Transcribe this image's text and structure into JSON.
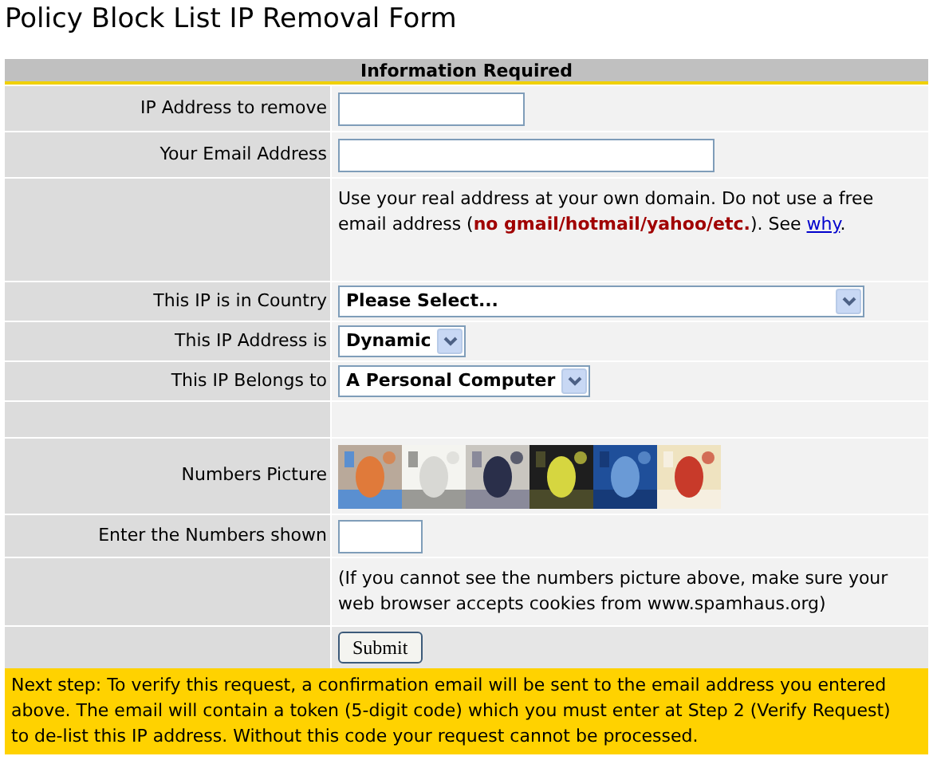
{
  "title": "Policy Block List IP Removal Form",
  "table": {
    "header": "Information Required",
    "rows": [
      {
        "kind": "field",
        "label": "IP Address to remove"
      },
      {
        "kind": "widefield",
        "label": "Your Email Address"
      },
      {
        "kind": "note",
        "text": "Use your real address at your own domain. Do not use a free email address (**no gmail/hotmail/yahoo/etc.**). See ",
        "link": "why",
        "after": "."
      },
      {
        "kind": "wideselect",
        "label": "This IP is in Country",
        "value": "Please Select..."
      },
      {
        "kind": "select",
        "label": "This IP Address is",
        "value": "Dynamic"
      },
      {
        "kind": "select",
        "label": "This IP Belongs to",
        "value": "A Personal Computer"
      },
      {
        "kind": "blank"
      },
      {
        "kind": "pictures",
        "label": "Numbers Picture"
      },
      {
        "kind": "smallfield",
        "label": "Enter the Numbers shown"
      },
      {
        "kind": "note",
        "text": "(If you cannot see the numbers picture above, make sure your web browser accepts cookies from www.spamhaus.org)"
      },
      {
        "kind": "button",
        "label": "Submit"
      }
    ]
  },
  "next_step": "Next step: To verify this request, a confirmation email will be sent to the email address you entered above. The email will contain a token (5-digit code) which you must enter at Step 2 (Verify Request) to de-list this IP address. Without this code your request cannot be processed."
}
